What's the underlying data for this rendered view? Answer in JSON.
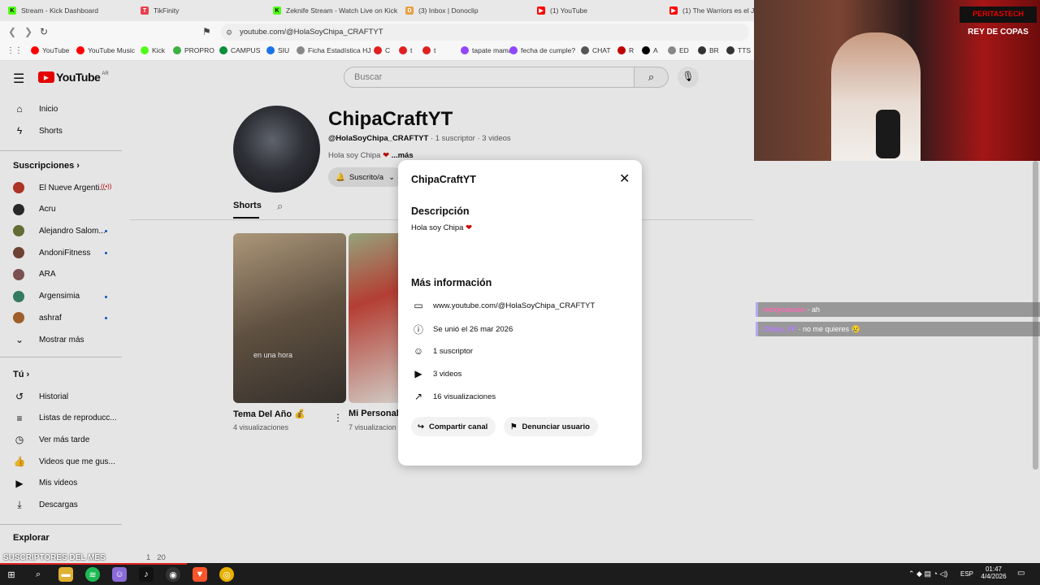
{
  "browser": {
    "tabs": [
      {
        "title": "Stream - Kick Dashboard",
        "icon": "kick-icon",
        "color": "#53fc18"
      },
      {
        "title": "TikFinity",
        "icon": "tikfinity-icon",
        "color": "#e8404e"
      },
      {
        "title": "Zeknife Stream - Watch Live on Kick",
        "icon": "kick-icon",
        "color": "#53fc18"
      },
      {
        "title": "(3) Inbox | Donoclip",
        "icon": "donoclip-icon",
        "color": "#e8a042"
      },
      {
        "title": "(1) YouTube",
        "icon": "youtube-icon",
        "color": "#ff0000"
      },
      {
        "title": "(1) The Warriors es el JUEGO",
        "icon": "youtube-icon",
        "color": "#ff0000"
      }
    ],
    "url": "youtube.com/@HolaSoyChipa_CRAFTYT",
    "bookmarks": [
      {
        "label": "YouTube",
        "color": "#ff0000"
      },
      {
        "label": "YouTube Music",
        "color": "#ff0000"
      },
      {
        "label": "Kick",
        "color": "#53fc18"
      },
      {
        "label": "PROPRO",
        "color": "#3bb143"
      },
      {
        "label": "CAMPUS",
        "color": "#0a8f3a"
      },
      {
        "label": "SIU",
        "color": "#1a73e8"
      },
      {
        "label": "Ficha Estadística HJ",
        "color": "#888888"
      },
      {
        "label": "C",
        "color": "#e02020"
      },
      {
        "label": "t",
        "color": "#e02020"
      },
      {
        "label": "t",
        "color": "#e02020"
      },
      {
        "label": "tapate mama!!",
        "color": "#9146ff"
      },
      {
        "label": "fecha de cumple?",
        "color": "#9146ff"
      },
      {
        "label": "CHAT",
        "color": "#555555"
      },
      {
        "label": "R",
        "color": "#c00000"
      },
      {
        "label": "A",
        "color": "#000000"
      },
      {
        "label": "ED",
        "color": "#888888"
      },
      {
        "label": "BR",
        "color": "#333333"
      },
      {
        "label": "TTS",
        "color": "#333333"
      }
    ]
  },
  "youtube": {
    "logo": "YouTube",
    "region": "AR",
    "search_placeholder": "Buscar",
    "sidebar": {
      "main": [
        {
          "label": "Inicio",
          "icon": "home-icon"
        },
        {
          "label": "Shorts",
          "icon": "shorts-icon"
        }
      ],
      "subs_title": "Suscripciones",
      "subscriptions": [
        {
          "label": "El Nueve Argenti...",
          "color": "#c0392b",
          "live": true
        },
        {
          "label": "Acru",
          "color": "#2d2d2d",
          "dot": false
        },
        {
          "label": "Alejandro Salom...",
          "color": "#6d7a3a",
          "dot": true
        },
        {
          "label": "AndoniFitness",
          "color": "#7b4a3a",
          "dot": true
        },
        {
          "label": "ARA",
          "color": "#8a5a5a",
          "dot": false
        },
        {
          "label": "Argensimia",
          "color": "#3a8a6a",
          "dot": true
        },
        {
          "label": "ashraf",
          "color": "#b06a30",
          "dot": true
        }
      ],
      "show_more": "Mostrar más",
      "you_title": "Tú",
      "you": [
        {
          "label": "Historial",
          "icon": "history-icon"
        },
        {
          "label": "Listas de reproducc...",
          "icon": "playlist-icon"
        },
        {
          "label": "Ver más tarde",
          "icon": "clock-icon"
        },
        {
          "label": "Videos que me gus...",
          "icon": "like-icon"
        },
        {
          "label": "Mis videos",
          "icon": "video-icon"
        },
        {
          "label": "Descargas",
          "icon": "download-icon"
        }
      ],
      "explore_title": "Explorar"
    },
    "channel": {
      "name": "ChipaCraftYT",
      "handle": "@HolaSoyChipa_CRAFTYT",
      "meta": "· 1 suscriptor · 3 videos",
      "desc": "Hola soy Chipa",
      "more": "...más",
      "subscribed": "Suscrito/a",
      "tab": "Shorts",
      "videos": [
        {
          "title": "Tema Del Año",
          "views": "4 visualizaciones",
          "overlay": "en una hora"
        },
        {
          "title": "Mi Personali",
          "views": "7 visualizacion",
          "overlay": ""
        }
      ]
    },
    "modal": {
      "title": "ChipaCraftYT",
      "desc_heading": "Descripción",
      "desc_text": "Hola soy Chipa",
      "info_heading": "Más información",
      "rows": [
        {
          "icon": "web-icon",
          "text": "www.youtube.com/@HolaSoyChipa_CRAFTYT"
        },
        {
          "icon": "info-icon",
          "text": "Se unió el 26 mar 2026"
        },
        {
          "icon": "subscribers-icon",
          "text": "1 suscriptor"
        },
        {
          "icon": "video-icon",
          "text": "3 videos"
        },
        {
          "icon": "trending-icon",
          "text": "16 visualizaciones"
        }
      ],
      "share": "Compartir canal",
      "report": "Denunciar usuario"
    }
  },
  "stream_overlay": {
    "chat": [
      {
        "user": "vickycaruso",
        "text": "ah",
        "color": "#ff69b4"
      },
      {
        "user": "Chipa_FF",
        "text": "no me quieres 😢",
        "color": "#b57bff"
      }
    ],
    "ticker": "SUSCRIPTORES DEL MES",
    "ticker_count": "1   20",
    "banner": "PERITASTECH",
    "banner2": "REY DE COPAS"
  },
  "taskbar": {
    "lang": "ESP",
    "time": "01:47",
    "date": "4/4/2026"
  }
}
